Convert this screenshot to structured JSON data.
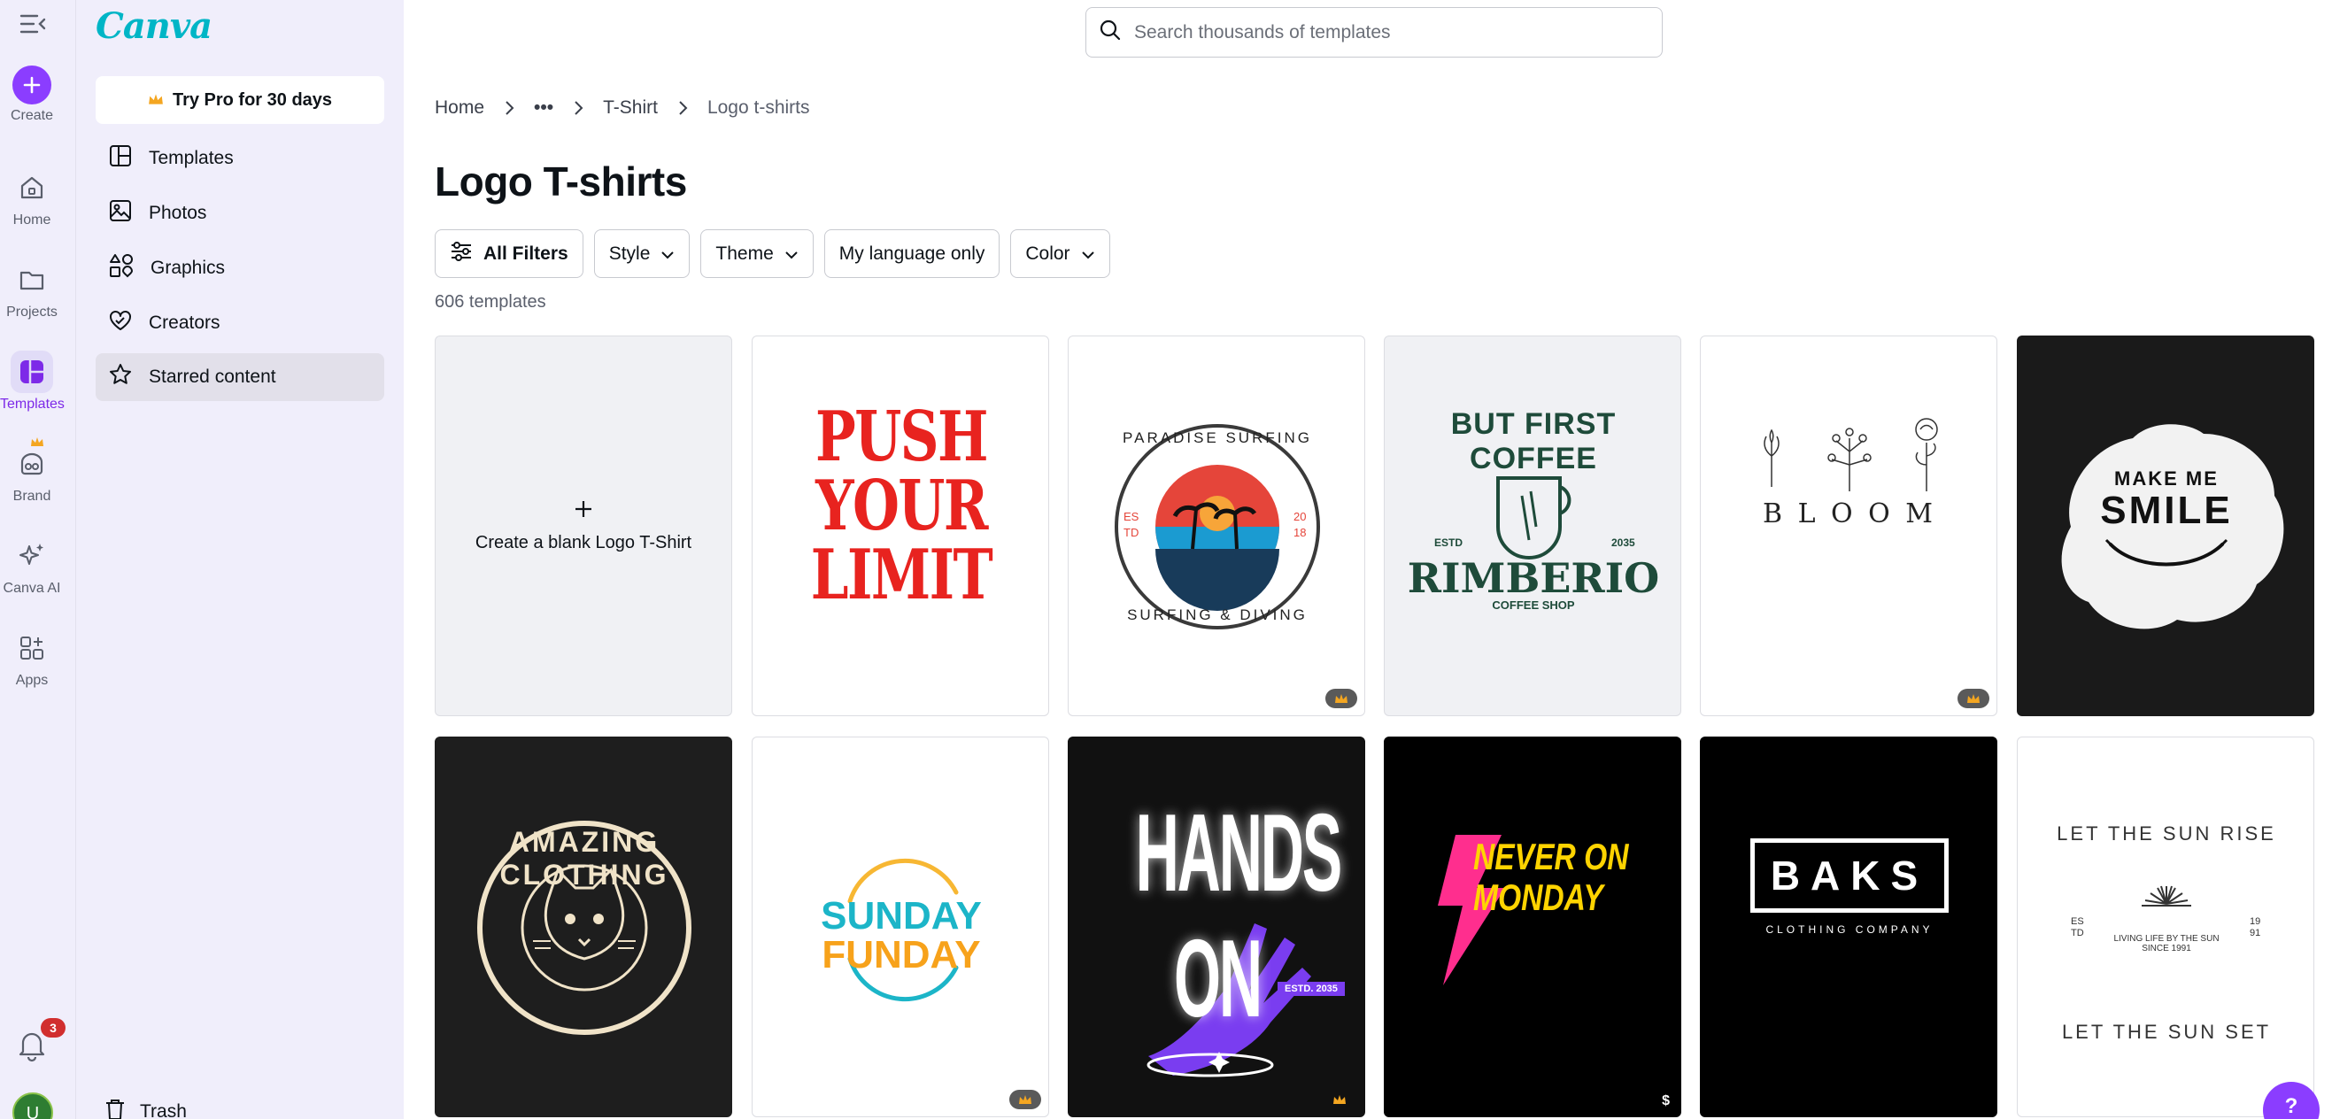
{
  "rail": {
    "create": "Create",
    "home": "Home",
    "projects": "Projects",
    "templates": "Templates",
    "brand": "Brand",
    "canva_ai": "Canva AI",
    "apps": "Apps",
    "notifications_count": "3",
    "user_initial": "U"
  },
  "sidebar": {
    "logo": "Canva",
    "pro_button": "Try Pro for 30 days",
    "items": [
      "Templates",
      "Photos",
      "Graphics",
      "Creators",
      "Starred content"
    ],
    "trash": "Trash"
  },
  "search": {
    "placeholder": "Search thousands of templates"
  },
  "breadcrumb": {
    "home": "Home",
    "ellipsis": "•••",
    "tshirt": "T-Shirt",
    "current": "Logo t-shirts"
  },
  "page_title": "Logo T-shirts",
  "filters": {
    "all": "All Filters",
    "style": "Style",
    "theme": "Theme",
    "language": "My language only",
    "color": "Color"
  },
  "template_count": "606 templates",
  "blank_card": "Create a blank Logo T-Shirt",
  "templates": {
    "t1": [
      "PUSH",
      "YOUR",
      "LIMIT"
    ],
    "t2": {
      "top": "PARADISE SURFING",
      "bottom": "SURFING & DIVING",
      "estd_l": "ES",
      "estd_l2": "TD",
      "yr_r": "20",
      "yr_r2": "18"
    },
    "t3": {
      "arc": "BUT FIRST COFFEE",
      "estd": "ESTD",
      "year": "2035",
      "name": "RIMBERIO",
      "sub": "COFFEE SHOP"
    },
    "t4": "B L O O M",
    "t5": {
      "top": "MAKE ME",
      "main": "SMILE"
    },
    "t6": "AMAZING CLOTHING",
    "t7": {
      "l1": "SUNDAY",
      "l2": "FUNDAY"
    },
    "t8": {
      "main": "HANDS ON",
      "tag": "ESTD. 2035"
    },
    "t9": {
      "l1": "NEVER ON",
      "l2": "MONDAY"
    },
    "t10": {
      "main": "BAKS",
      "sub": "CLOTHING COMPANY"
    },
    "t11": {
      "top": "LET THE SUN RISE",
      "mid": "LIVING LIFE BY THE SUN SINCE 1991",
      "bottom": "LET THE SUN SET",
      "l": "ES",
      "l2": "TD",
      "r": "19",
      "r2": "91"
    },
    "dollar": "$"
  },
  "help": "?"
}
